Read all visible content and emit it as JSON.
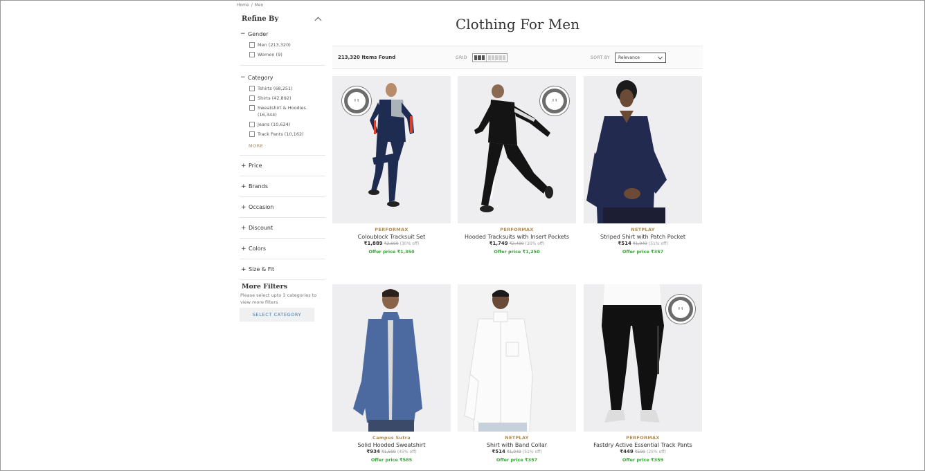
{
  "breadcrumb": [
    "Home",
    "/",
    "Men"
  ],
  "sidebar": {
    "title": "Refine By",
    "gender": {
      "title": "Gender",
      "options": [
        "Men (213,320)",
        "Women (9)"
      ]
    },
    "category": {
      "title": "Category",
      "options": [
        "Tshirts (68,251)",
        "Shirts (42,892)",
        "Sweatshirt & Hoodies (16,344)",
        "Jeans (10,634)",
        "Track Pants (10,162)"
      ],
      "more": "MORE"
    },
    "facets": [
      "Price",
      "Brands",
      "Occasion",
      "Discount",
      "Colors",
      "Size & Fit"
    ],
    "more_filters": {
      "title": "More Filters",
      "note": "Please select upto 3 categories to view more filters",
      "button": "SELECT CATEGORY"
    }
  },
  "main": {
    "title": "Clothing For Men",
    "items_found": "213,320 Items Found",
    "grid_label": "GRID",
    "sort_label": "SORT BY",
    "sort_value": "Relevance"
  },
  "products": [
    {
      "brand": "PERFORMAX",
      "name": "Coloublock Tracksuit Set",
      "price": "₹1,889",
      "mrp": "₹2,699",
      "disc": "(30% off)",
      "offer": "Offer price ₹1,350",
      "badge": true
    },
    {
      "brand": "PERFORMAX",
      "name": "Hooded Tracksuits with Insert Pockets",
      "price": "₹1,749",
      "mrp": "₹2,499",
      "disc": "(30% off)",
      "offer": "Offer price ₹1,250",
      "badge": true
    },
    {
      "brand": "NETPLAY",
      "name": "Striped Shirt with Patch Pocket",
      "price": "₹514",
      "mrp": "₹1,049",
      "disc": "(51% off)",
      "offer": "Offer price ₹357",
      "badge": false
    },
    {
      "brand": "Campus Sutra",
      "name": "Solid Hooded Sweatshirt",
      "price": "₹934",
      "mrp": "₹1,699",
      "disc": "(45% off)",
      "offer": "Offer price ₹585",
      "badge": false
    },
    {
      "brand": "NETPLAY",
      "name": "Shirt with Band Collar",
      "price": "₹514",
      "mrp": "₹1,049",
      "disc": "(51% off)",
      "offer": "Offer price ₹357",
      "badge": false
    },
    {
      "brand": "PERFORMAX",
      "name": "Fastdry Active Essential Track Pants",
      "price": "₹449",
      "mrp": "₹599",
      "disc": "(25% off)",
      "offer": "Offer price ₹359",
      "badge": true
    }
  ],
  "colors": {
    "brand": "#b08a4e",
    "offer": "#3aa23a",
    "link": "#3a78a8"
  }
}
